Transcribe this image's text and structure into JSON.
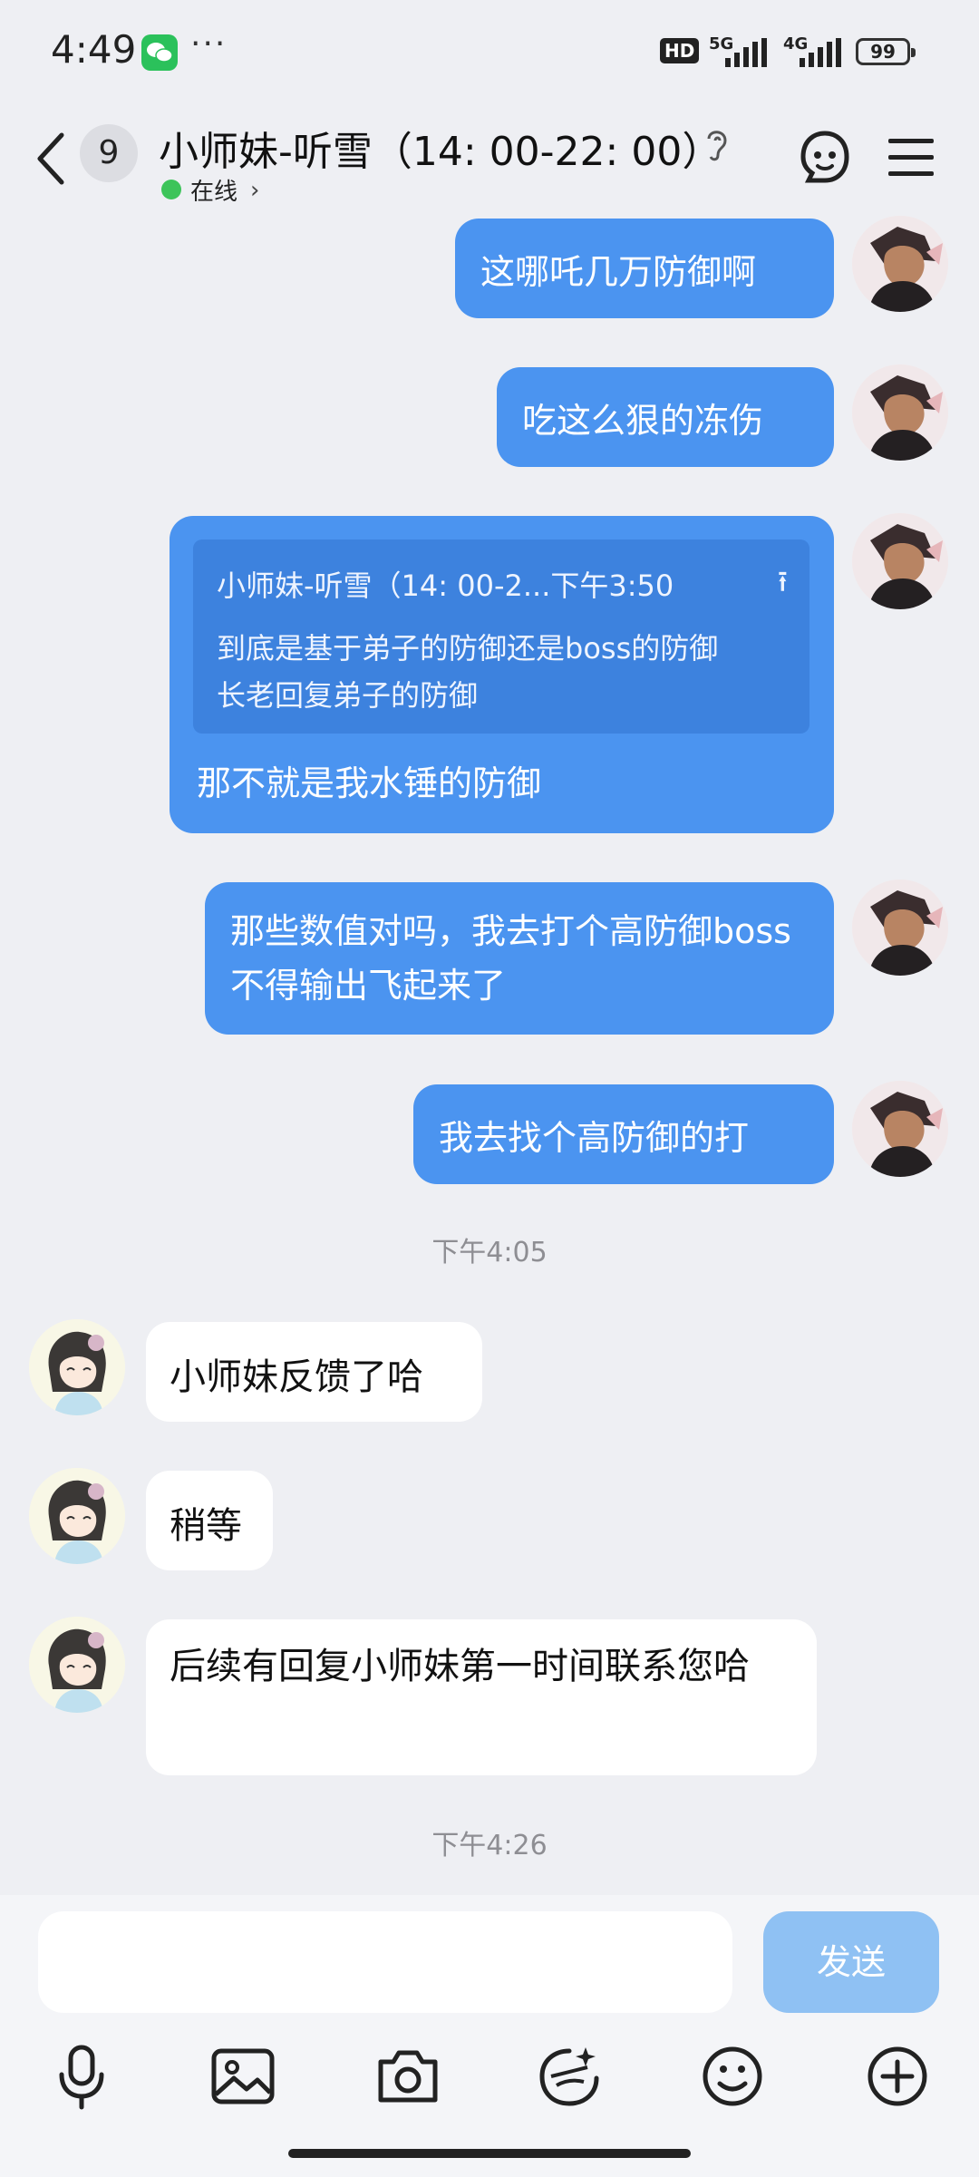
{
  "status": {
    "time": "4:49",
    "hd": "HD",
    "net1": "5G",
    "net2": "4G",
    "battery": "99"
  },
  "header": {
    "unread": "9",
    "title": "小师妹-听雪（14: 00-22: 00）",
    "online": "在线"
  },
  "messages": {
    "m1": "这哪吒几万防御啊",
    "m2": "吃这么狠的冻伤",
    "m3_quote_head": "小师妹-听雪（14: 00-2...下午3:50",
    "m3_quote_line1": "到底是基于弟子的防御还是boss的防御",
    "m3_quote_line2": "长老回复弟子的防御",
    "m3_text": "那不就是我水锤的防御",
    "m4": "那些数值对吗，我去打个高防御boss不得输出飞起来了",
    "m5": "我去找个高防御的打",
    "ts1": "下午4:05",
    "r1": "小师妹反馈了哈",
    "r2": "稍等",
    "r3": "后续有回复小师妹第一时间联系您哈",
    "ts2": "下午4:26"
  },
  "input": {
    "placeholder": "",
    "send_label": "发送"
  },
  "colors": {
    "my_bubble": "#4b94f0",
    "send_disabled": "#8fc1f3",
    "online": "#3dc45a"
  }
}
